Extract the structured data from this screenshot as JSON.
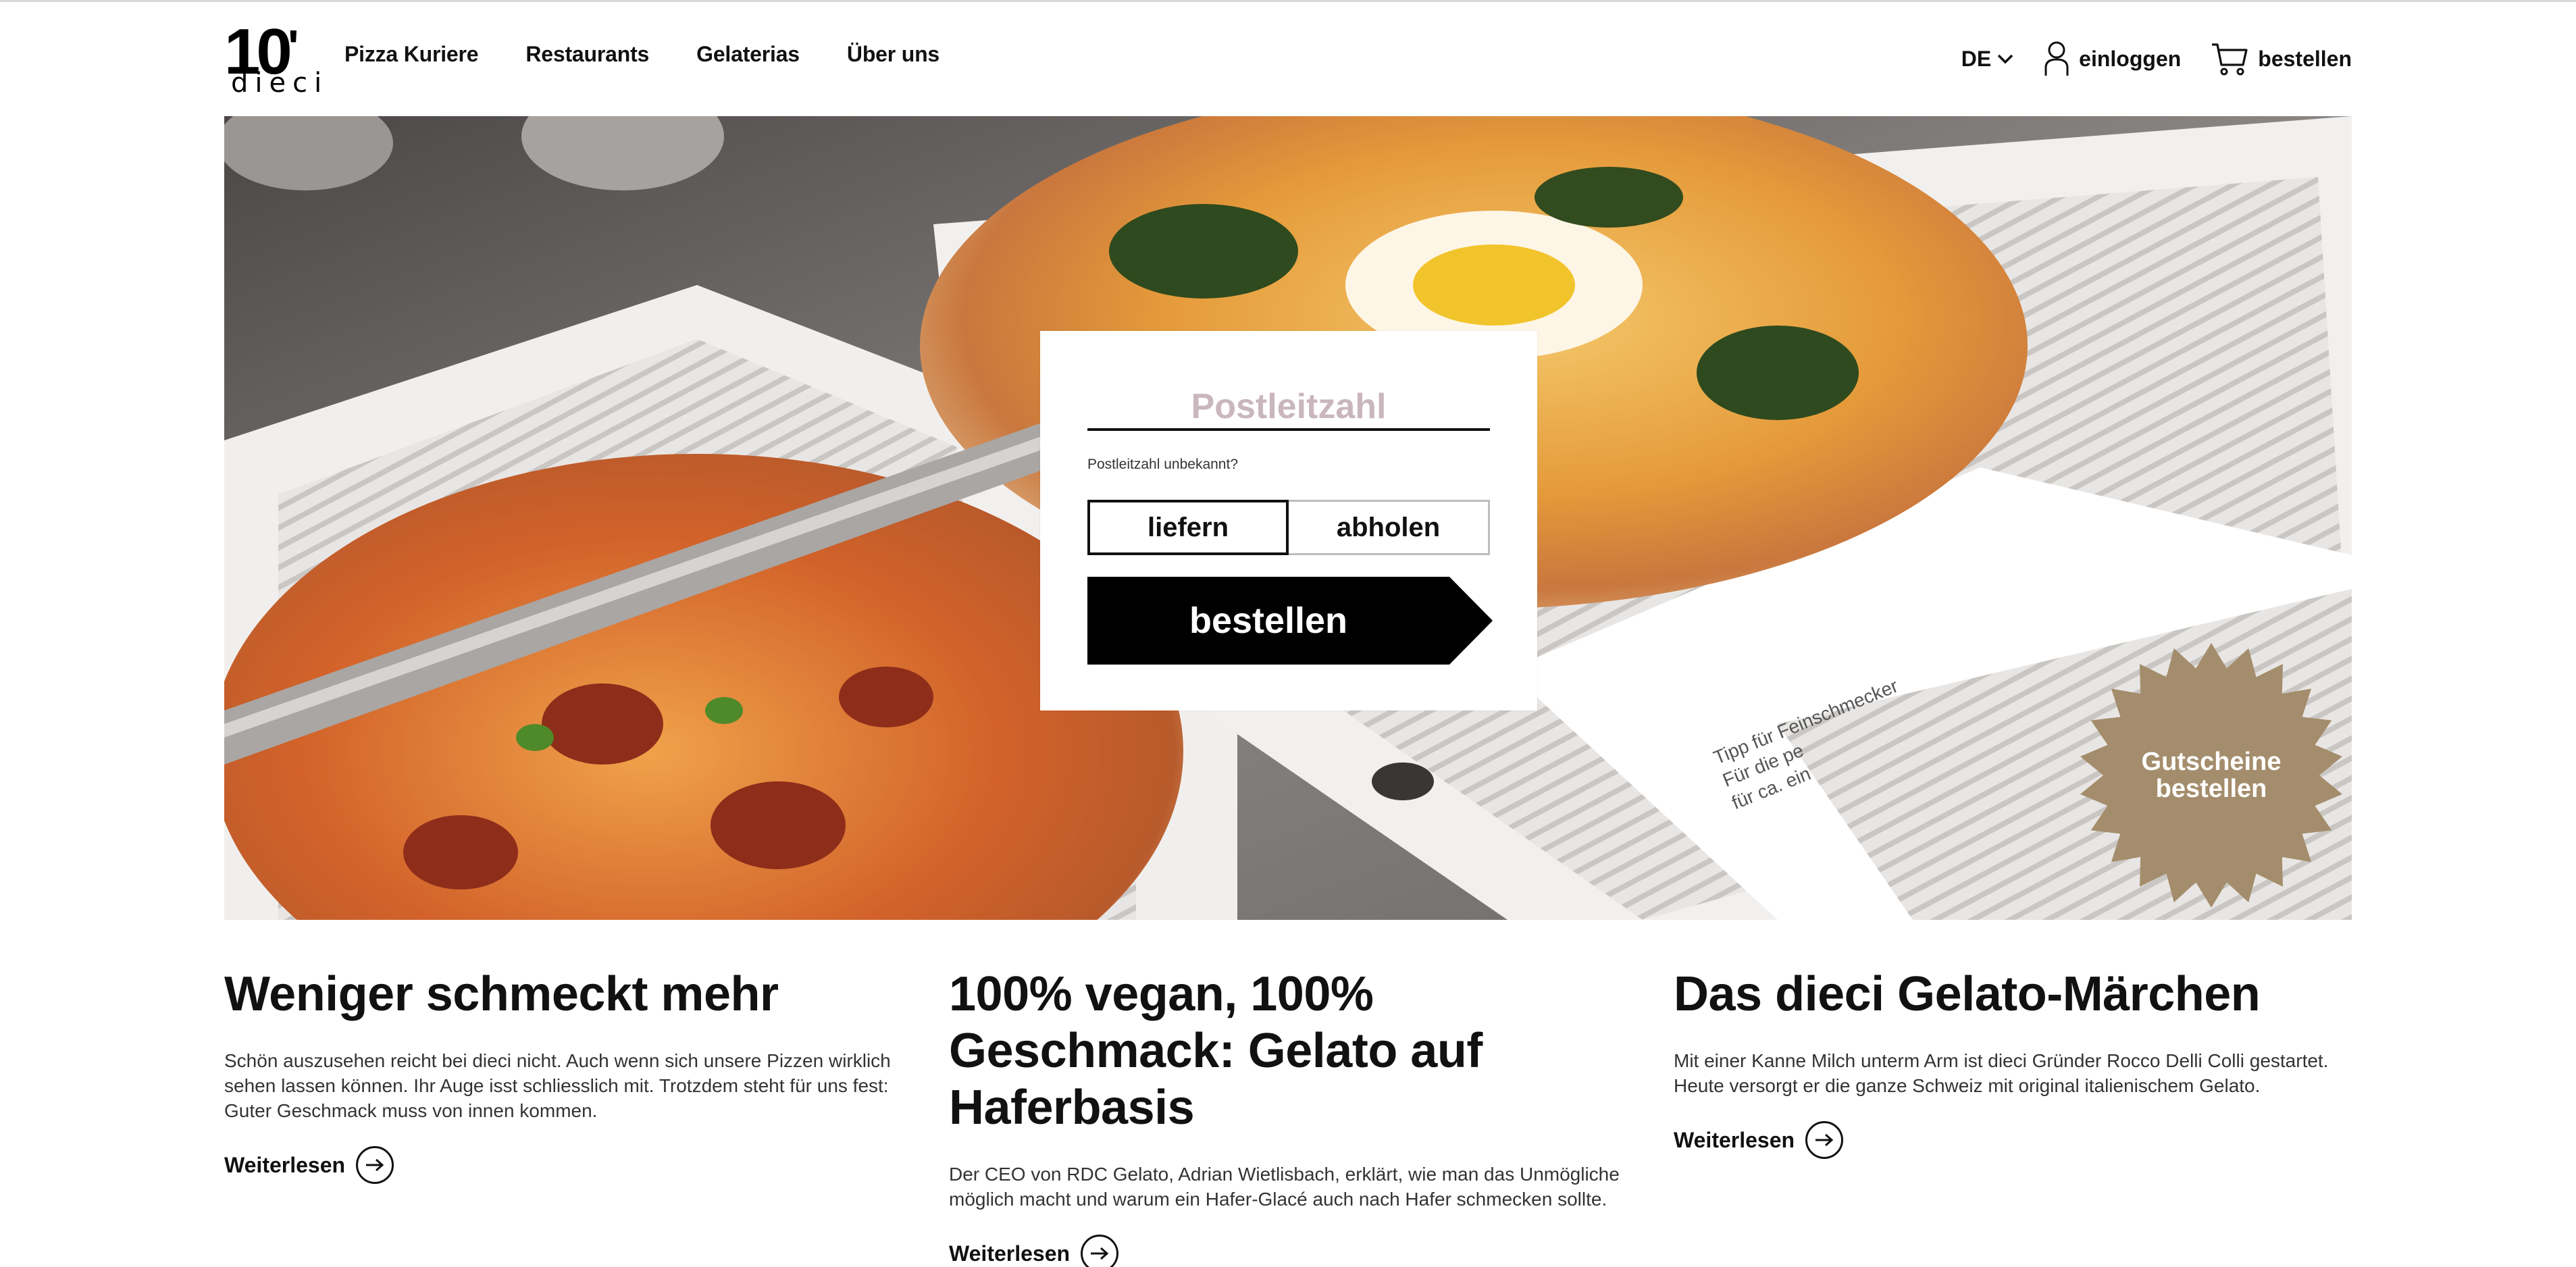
{
  "header": {
    "logo_number": "10",
    "logo_word": "dieci",
    "nav": [
      "Pizza Kuriere",
      "Restaurants",
      "Gelaterias",
      "Über uns"
    ],
    "language": "DE",
    "login_label": "einloggen",
    "cart_label": "bestellen"
  },
  "order_form": {
    "postcode_placeholder": "Postleitzahl",
    "postcode_value": "",
    "postcode_unknown": "Postleitzahl unbekannt?",
    "mode_deliver": "liefern",
    "mode_pickup": "abholen",
    "selected_mode": "liefern",
    "order_button": "bestellen"
  },
  "voucher": {
    "line1": "Gutscheine",
    "line2": "bestellen",
    "color": "#a48d6c"
  },
  "articles": [
    {
      "title": "Weniger schmeckt mehr",
      "text": "Schön auszusehen reicht bei dieci nicht. Auch wenn sich unsere Pizzen wirklich sehen lassen können. Ihr Auge isst schliesslich mit. Trotzdem steht für uns fest: Guter Geschmack muss von innen kommen.",
      "link": "Weiterlesen"
    },
    {
      "title": "100% vegan, 100% Geschmack: Gelato auf Haferbasis",
      "text": "Der CEO von RDC Gelato, Adrian Wietlisbach, erklärt, wie man das Unmögliche möglich macht und warum ein Hafer-Glacé auch nach Hafer schmecken sollte.",
      "link": "Weiterlesen"
    },
    {
      "title": "Das dieci Gelato-Märchen",
      "text": "Mit einer Kanne Milch unterm Arm ist dieci Gründer Rocco Delli Colli gestartet. Heute versorgt er die ganze Schweiz mit original italienischem Gelato.",
      "link": "Weiterlesen"
    }
  ],
  "hero": {
    "box_print_line1": "Tipp für Feinschmecker",
    "box_print_line2": "Für die pe",
    "box_print_line3": "für ca. ein"
  },
  "icons": [
    "chevron-down-icon",
    "user-icon",
    "cart-icon",
    "arrow-right-icon"
  ]
}
